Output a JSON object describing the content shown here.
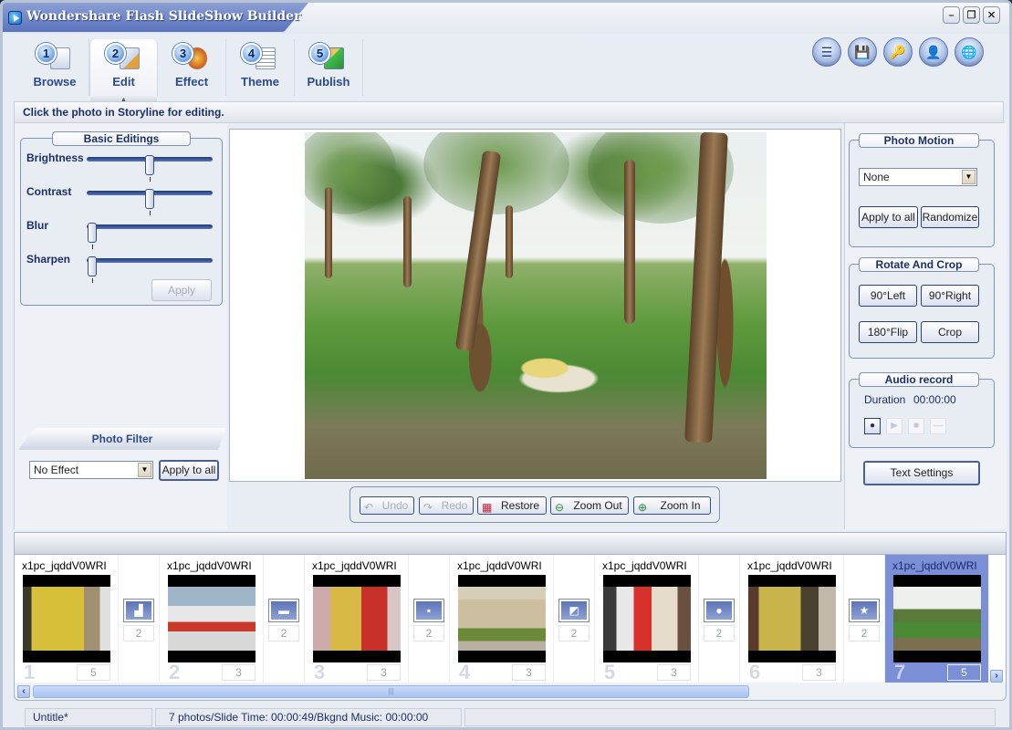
{
  "window": {
    "title": "Wondershare Flash SlideShow Builder",
    "controls": [
      "minimize",
      "restore",
      "close"
    ]
  },
  "steps": [
    {
      "number": "1",
      "label": "Browse",
      "icon": "browse-icon",
      "active": false
    },
    {
      "number": "2",
      "label": "Edit",
      "icon": "edit-icon",
      "active": true
    },
    {
      "number": "3",
      "label": "Effect",
      "icon": "effect-icon",
      "active": false
    },
    {
      "number": "4",
      "label": "Theme",
      "icon": "theme-icon",
      "active": false
    },
    {
      "number": "5",
      "label": "Publish",
      "icon": "publish-icon",
      "active": false
    }
  ],
  "toolbar": [
    {
      "name": "menu-icon",
      "glyph": "☰"
    },
    {
      "name": "save-icon",
      "glyph": "💾"
    },
    {
      "name": "key-icon",
      "glyph": "🔑"
    },
    {
      "name": "user-icon",
      "glyph": "👤"
    },
    {
      "name": "globe-icon",
      "glyph": "🌐"
    }
  ],
  "hint": "Click the photo in Storyline for editing.",
  "basic_editings": {
    "title": "Basic Editings",
    "sliders": [
      {
        "label": "Brightness",
        "value": 0.5
      },
      {
        "label": "Contrast",
        "value": 0.5
      },
      {
        "label": "Blur",
        "value": 0.0
      },
      {
        "label": "Sharpen",
        "value": 0.0
      }
    ],
    "apply_label": "Apply"
  },
  "photo_filter": {
    "title": "Photo Filter",
    "selected": "No Effect",
    "apply_all_label": "Apply to all"
  },
  "edit_toolbar": {
    "undo": "Undo",
    "redo": "Redo",
    "restore": "Restore",
    "zoom_out": "Zoom Out",
    "zoom_in": "Zoom In"
  },
  "photo_motion": {
    "title": "Photo Motion",
    "selected": "None",
    "apply_all_label": "Apply to all",
    "randomize_label": "Randomize"
  },
  "rotate_crop": {
    "title": "Rotate And Crop",
    "left": "90°Left",
    "right": "90°Right",
    "flip": "180°Flip",
    "crop": "Crop"
  },
  "audio_record": {
    "title": "Audio record",
    "duration_label": "Duration",
    "duration_value": "00:00:00"
  },
  "text_settings_label": "Text Settings",
  "storyline": {
    "slides": [
      {
        "name": "x1pc_jqddV0WRI",
        "number": "1",
        "duration": "5",
        "selected": false
      },
      {
        "name": "x1pc_jqddV0WRI",
        "number": "2",
        "duration": "3",
        "selected": false
      },
      {
        "name": "x1pc_jqddV0WRI",
        "number": "3",
        "duration": "3",
        "selected": false
      },
      {
        "name": "x1pc_jqddV0WRI",
        "number": "4",
        "duration": "3",
        "selected": false
      },
      {
        "name": "x1pc_jqddV0WRI",
        "number": "5",
        "duration": "3",
        "selected": false
      },
      {
        "name": "x1pc_jqddV0WRI",
        "number": "6",
        "duration": "3",
        "selected": false
      },
      {
        "name": "x1pc_jqddV0WRI",
        "number": "7",
        "duration": "5",
        "selected": true
      }
    ],
    "transitions": [
      {
        "duration": "2",
        "glyph": "▟"
      },
      {
        "duration": "2",
        "glyph": "▬"
      },
      {
        "duration": "2",
        "glyph": "▪"
      },
      {
        "duration": "2",
        "glyph": "◩"
      },
      {
        "duration": "2",
        "glyph": "●"
      },
      {
        "duration": "2",
        "glyph": "★"
      }
    ]
  },
  "status": {
    "project": "Untitle*",
    "summary": "7 photos/Slide Time: 00:00:49/Bkgnd Music: 00:00:00"
  }
}
